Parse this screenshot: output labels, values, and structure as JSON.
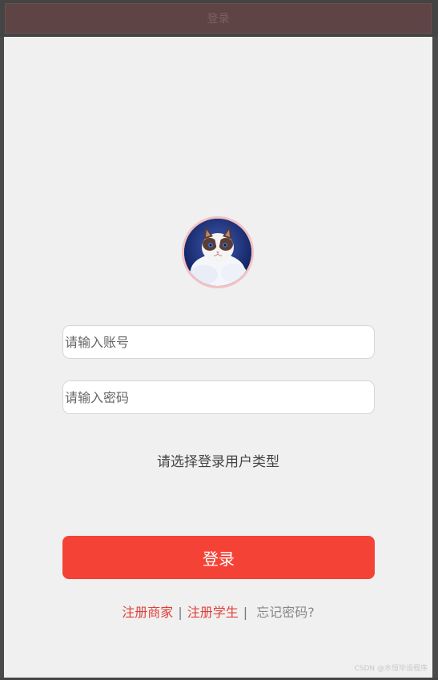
{
  "header": {
    "title": "登录"
  },
  "login": {
    "account_placeholder": "请输入账号",
    "password_placeholder": "请输入密码",
    "user_type_prompt": "请选择登录用户类型",
    "submit_label": "登录"
  },
  "links": {
    "register_merchant": "注册商家",
    "separator1": "|",
    "register_student": "注册学生",
    "separator2": "|",
    "forgot_password": "忘记密码?"
  },
  "watermark": "CSDN @水恒毕设程序"
}
